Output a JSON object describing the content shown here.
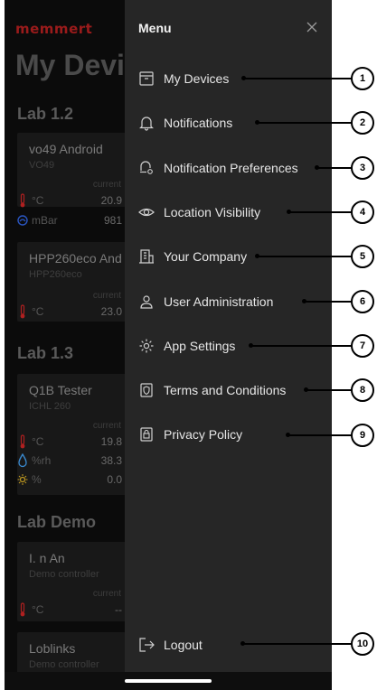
{
  "background_app": {
    "logo": "memmert",
    "title": "My Devi",
    "sections": [
      {
        "label": "Lab 1.2",
        "cards": [
          {
            "name": "vo49 Android",
            "model": "VO49",
            "current_label": "current",
            "rows": [
              {
                "icon": "thermometer-icon",
                "unit": "°C",
                "value": "20.9"
              },
              {
                "icon": "pressure-gauge-icon",
                "unit": "mBar",
                "value": "981"
              }
            ]
          },
          {
            "name": "HPP260eco And",
            "model": "HPP260eco",
            "current_label": "current",
            "rows": [
              {
                "icon": "thermometer-icon",
                "unit": "°C",
                "value": "23.0"
              }
            ]
          }
        ]
      },
      {
        "label": "Lab 1.3",
        "cards": [
          {
            "name": "Q1B Tester",
            "model": "ICHL 260",
            "current_label": "current",
            "rows": [
              {
                "icon": "thermometer-icon",
                "unit": "°C",
                "value": "19.8"
              },
              {
                "icon": "humidity-drop-icon",
                "unit": "%rh",
                "value": "38.3"
              },
              {
                "icon": "light-sun-icon",
                "unit": "%",
                "value": "0.0"
              }
            ]
          }
        ]
      },
      {
        "label": "Lab Demo",
        "cards": [
          {
            "name": "I. n An",
            "model": "Demo controller",
            "current_label": "current",
            "rows": [
              {
                "icon": "thermometer-icon",
                "unit": "°C",
                "value": "--"
              }
            ]
          },
          {
            "name": "Loblinks",
            "model": "Demo controller",
            "current_label": "",
            "rows": []
          }
        ]
      }
    ]
  },
  "menu": {
    "title": "Menu",
    "close_icon": "close-icon",
    "items": [
      {
        "label": "My Devices",
        "icon": "devices-box-icon",
        "callout": "1"
      },
      {
        "label": "Notifications",
        "icon": "bell-icon",
        "callout": "2"
      },
      {
        "label": "Notification Preferences",
        "icon": "bell-settings-icon",
        "callout": "3"
      },
      {
        "label": "Location Visibility",
        "icon": "eye-icon",
        "callout": "4"
      },
      {
        "label": "Your Company",
        "icon": "building-icon",
        "callout": "5"
      },
      {
        "label": "User Administration",
        "icon": "user-icon",
        "callout": "6"
      },
      {
        "label": "App Settings",
        "icon": "gear-icon",
        "callout": "7"
      },
      {
        "label": "Terms and Conditions",
        "icon": "shield-document-icon",
        "callout": "8"
      },
      {
        "label": "Privacy Policy",
        "icon": "lock-document-icon",
        "callout": "9"
      }
    ],
    "logout": {
      "label": "Logout",
      "icon": "logout-arrow-icon",
      "callout": "10"
    }
  },
  "colors": {
    "drawer_bg": "#262626",
    "background_app": "#0b0b0b",
    "brand_red": "#9a1b1b",
    "menu_text": "#e6e6e6"
  }
}
